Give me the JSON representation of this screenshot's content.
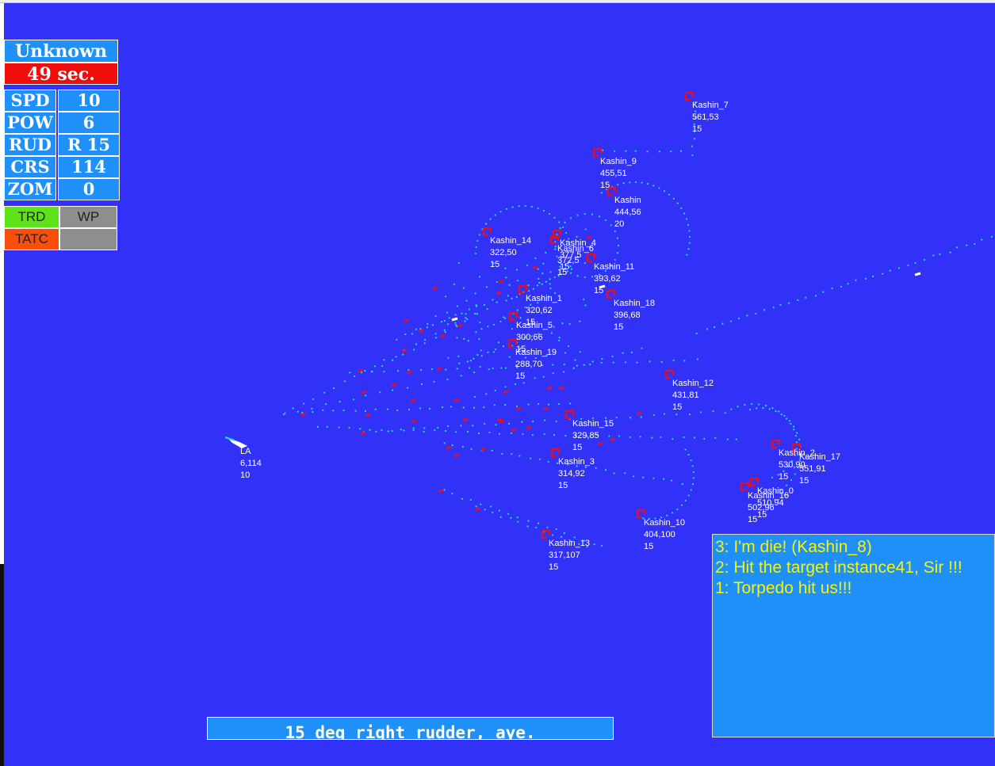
{
  "header": {
    "contact": "Unknown",
    "timer": "49 sec."
  },
  "stats": [
    {
      "label": "SPD",
      "value": "10"
    },
    {
      "label": "POW",
      "value": "6"
    },
    {
      "label": "RUD",
      "value": "R 15"
    },
    {
      "label": "CRS",
      "value": "114"
    },
    {
      "label": "ZOM",
      "value": "0"
    }
  ],
  "buttons": {
    "trd": "TRD",
    "wp": "WP",
    "tatc": "TATC",
    "blank": ""
  },
  "colors": {
    "ocean": "#3131f7",
    "panel": "#1f90f7",
    "alert": "#f20d0d",
    "trd": "#5ee21a",
    "tatc": "#f94f0d",
    "inactive": "#8e8e8e",
    "message_text": "#f4f40a",
    "enemy": "#e0102a",
    "track": "#22e0d0"
  },
  "messages": [
    "3: I'm die! (Kashin_8)",
    "2: Hit the target instance41, Sir !!!",
    "1: Torpedo hit us!!!"
  ],
  "command": "15 deg right rudder, aye.",
  "player": {
    "name": "LA",
    "pos": "6,114",
    "speed": "10"
  },
  "contacts": [
    {
      "name": "Kashin_7",
      "pos": "561,53",
      "speed": "15"
    },
    {
      "name": "Kashin_9",
      "pos": "455,51",
      "speed": "15"
    },
    {
      "name": "Kashin",
      "pos": "444,56",
      "speed": "20"
    },
    {
      "name": "Kashin_14",
      "pos": "322,50",
      "speed": "15"
    },
    {
      "name": "Kashin_4",
      "pos": "377,5",
      "speed": "15"
    },
    {
      "name": "Kashin_6",
      "pos": "372,5",
      "speed": "15"
    },
    {
      "name": "Kashin_11",
      "pos": "393,62",
      "speed": "15"
    },
    {
      "name": "Kashin_1",
      "pos": "320,62",
      "speed": "15"
    },
    {
      "name": "Kashin_18",
      "pos": "396,68",
      "speed": "15"
    },
    {
      "name": "Kashin_5",
      "pos": "300,66",
      "speed": "15"
    },
    {
      "name": "Kashin_19",
      "pos": "288,70",
      "speed": "15"
    },
    {
      "name": "Kashin_12",
      "pos": "431,81",
      "speed": "15"
    },
    {
      "name": "Kashin_15",
      "pos": "329,85",
      "speed": "15"
    },
    {
      "name": "Kashin_3",
      "pos": "314,92",
      "speed": "15"
    },
    {
      "name": "Kashin_2",
      "pos": "530,90",
      "speed": "15"
    },
    {
      "name": "Kashin_17",
      "pos": "551,91",
      "speed": "15"
    },
    {
      "name": "Kashin_0",
      "pos": "510,94",
      "speed": "15"
    },
    {
      "name": "Kashin_16",
      "pos": "502,96",
      "speed": "15"
    },
    {
      "name": "Kashin_10",
      "pos": "404,100",
      "speed": "15"
    },
    {
      "name": "Kashin_13",
      "pos": "317,107",
      "speed": "15"
    }
  ]
}
